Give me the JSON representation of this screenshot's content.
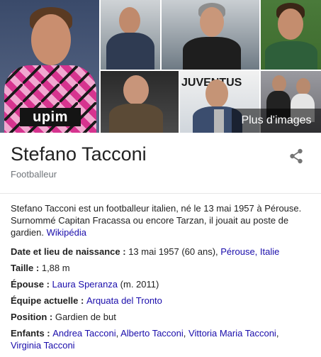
{
  "images": {
    "more_label": "Plus d'images",
    "main_sponsor": "upim",
    "sign_text": "JUVENTUS"
  },
  "entity": {
    "name": "Stefano Tacconi",
    "type": "Footballeur"
  },
  "description": {
    "text": "Stefano Tacconi est un footballeur italien, né le 13 mai 1957 à Pérouse. Surnommé Capitan Fracassa ou encore Tarzan, il jouait au poste de gardien.",
    "source": "Wikipédia"
  },
  "facts": {
    "birth": {
      "label": "Date et lieu de naissance",
      "value": "13 mai 1957 (60 ans), ",
      "place": "Pérouse, Italie"
    },
    "height": {
      "label": "Taille",
      "value": "1,88 m"
    },
    "spouse": {
      "label": "Épouse",
      "name": "Laura Speranza",
      "extra": " (m. 2011)"
    },
    "team": {
      "label": "Équipe actuelle",
      "value": "Arquata del Tronto"
    },
    "position": {
      "label": "Position",
      "value": "Gardien de but"
    },
    "children": {
      "label": "Enfants",
      "names": [
        "Andrea Tacconi",
        "Alberto Tacconi",
        "Vittoria Maria Tacconi",
        "Virginia Tacconi"
      ]
    }
  },
  "icons": {
    "share": "share-icon"
  },
  "colors": {
    "link": "#1a0dab",
    "muted": "#70757a",
    "jersey": "#d6348f"
  }
}
